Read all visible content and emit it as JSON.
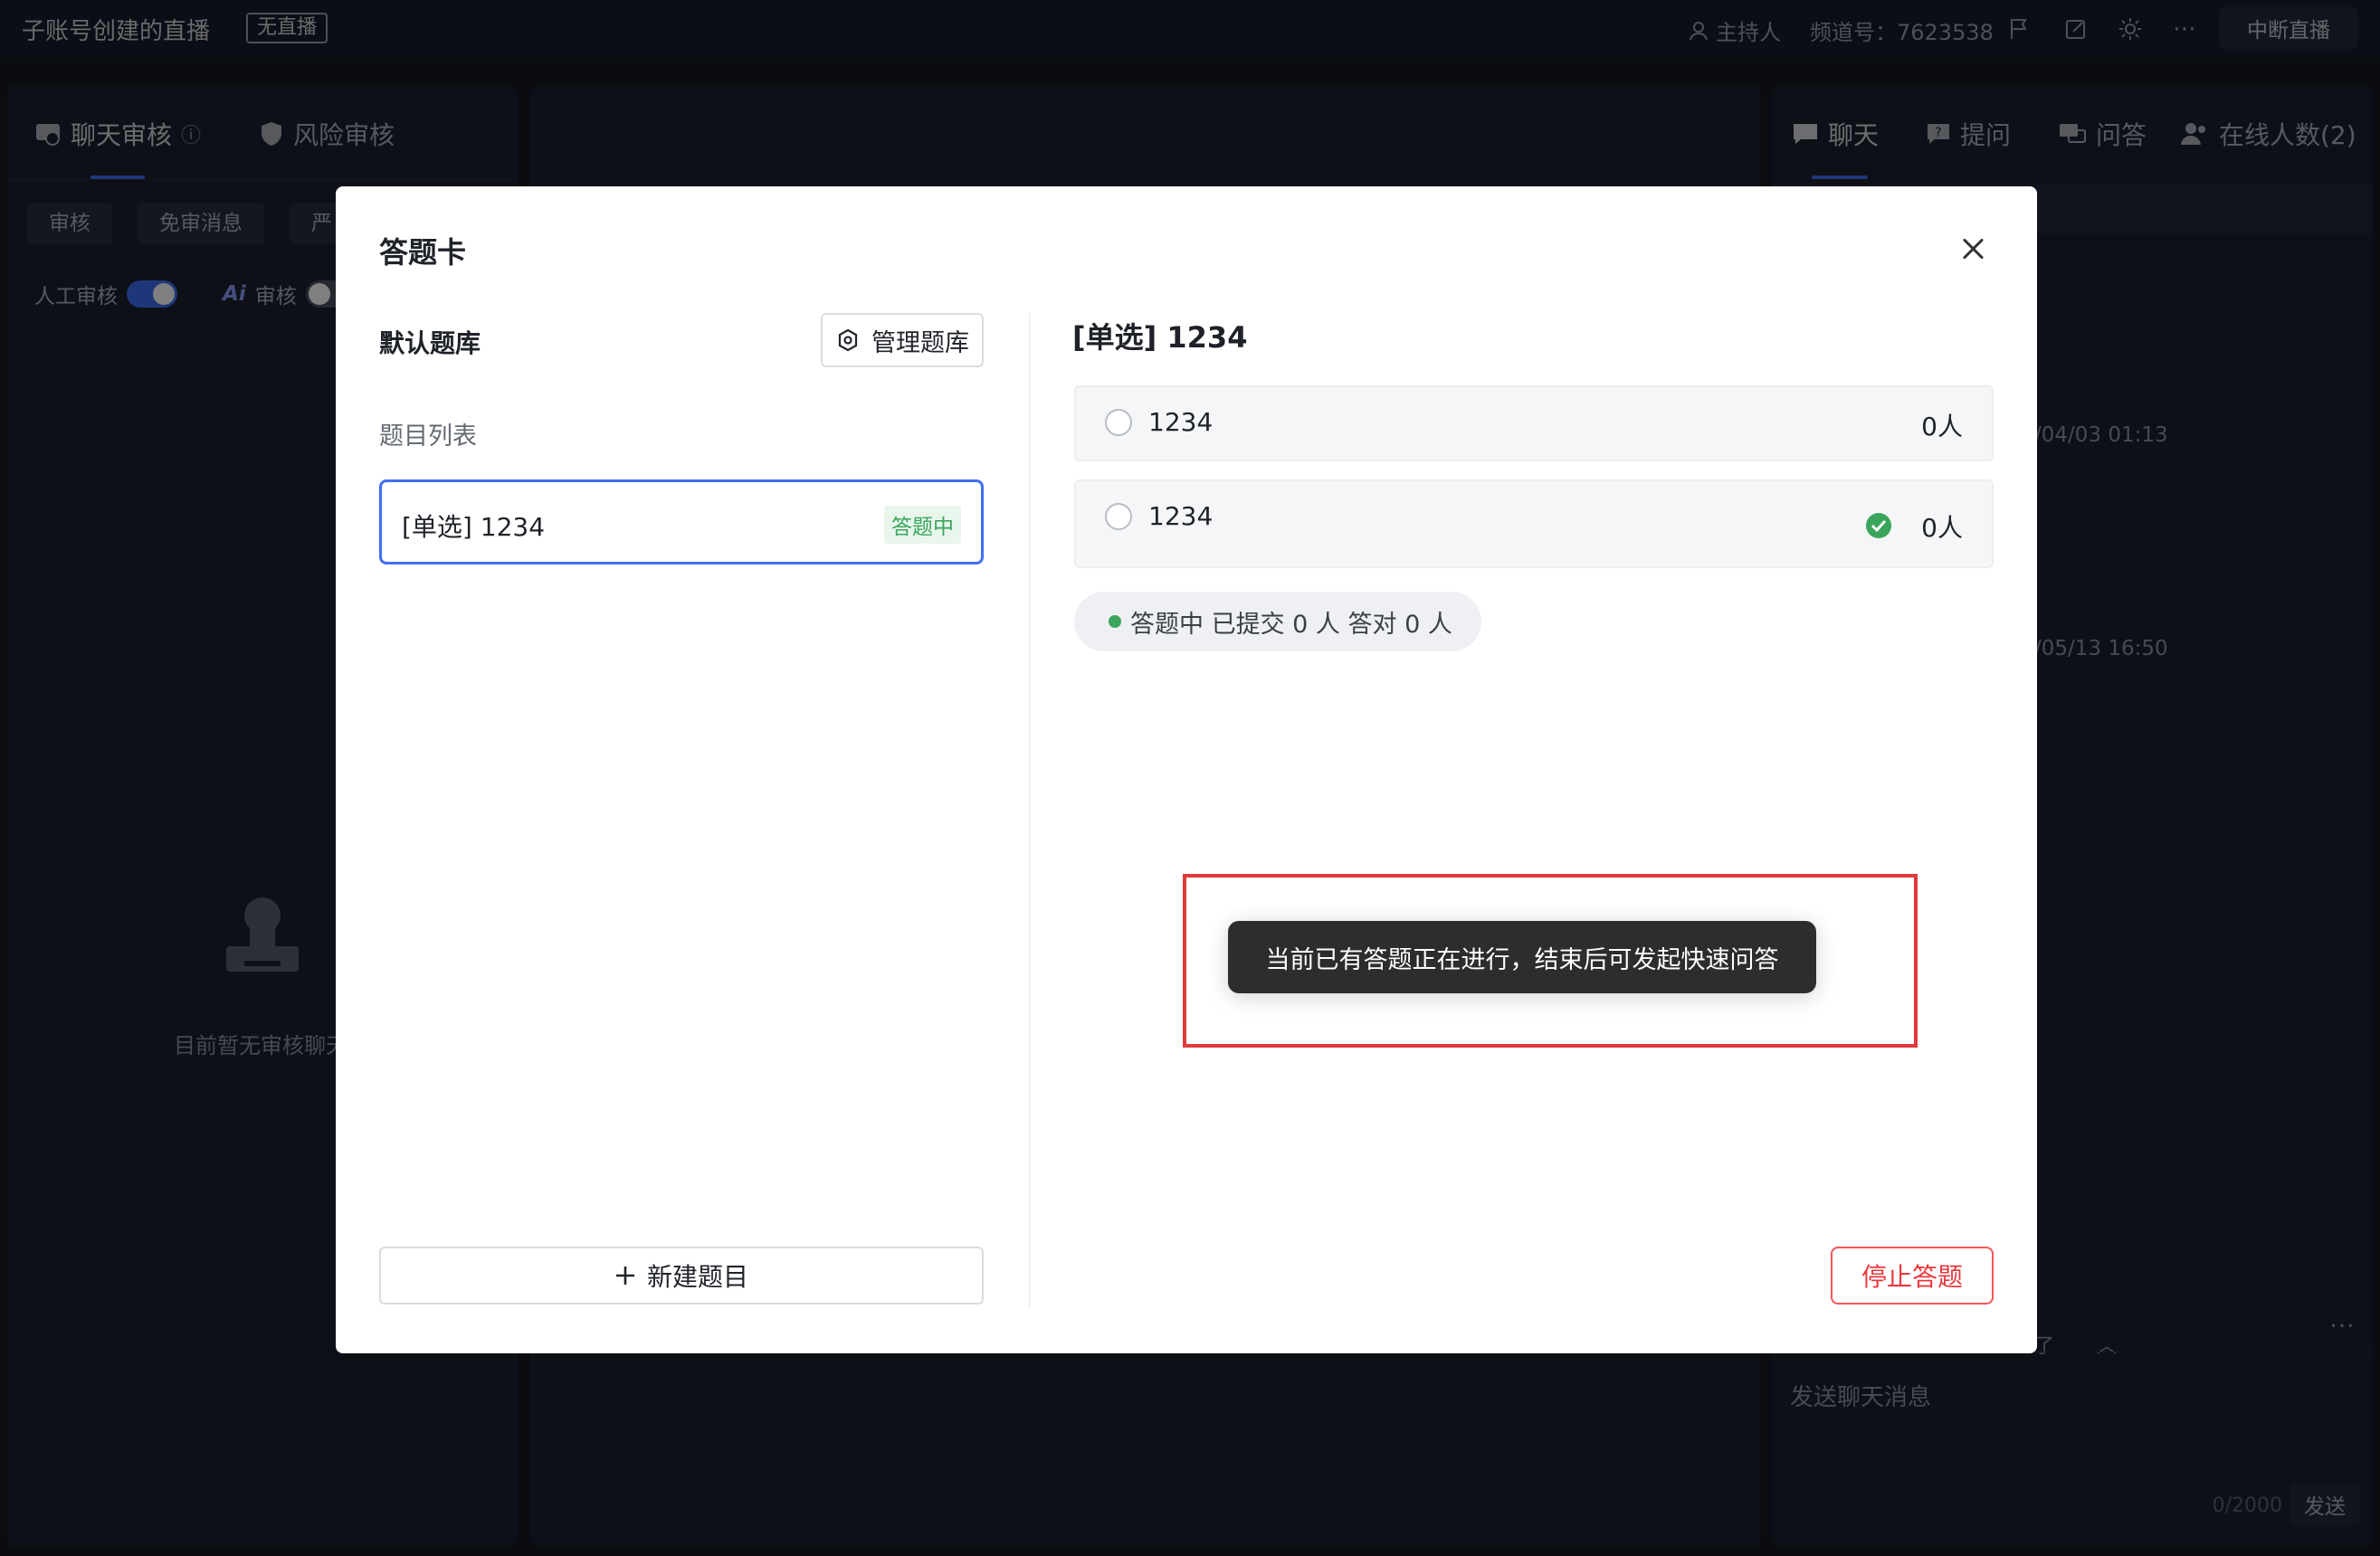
{
  "topbar": {
    "title": "子账号创建的直播",
    "live_badge": "无直播",
    "host_label": "主持人",
    "channel_label": "频道号：7623538",
    "end_live_label": "中断直播"
  },
  "left_panel": {
    "tabs": [
      {
        "label": "聊天审核",
        "icon": "chat-review-icon"
      },
      {
        "label": "风险审核",
        "icon": "shield-icon"
      }
    ],
    "chips": [
      "审核",
      "免审消息",
      "严"
    ],
    "toggles": [
      {
        "label": "人工审核",
        "on": true
      },
      {
        "label": "审核",
        "prefix": "Ai",
        "on": false
      }
    ],
    "empty_text": "目前暂无审核聊天"
  },
  "right_panel": {
    "tabs": [
      {
        "label": "聊天",
        "icon": "chat-icon"
      },
      {
        "label": "提问",
        "icon": "question-icon"
      },
      {
        "label": "问答",
        "icon": "qa-icon"
      },
      {
        "label": "在线人数(2)",
        "icon": "users-icon"
      }
    ],
    "timestamps": [
      "/04/03 01:13",
      "/05/13 16:50"
    ],
    "hint_fragment": "了",
    "input_placeholder": "发送聊天消息",
    "counter": "0/2000",
    "send_label": "发送"
  },
  "modal": {
    "title": "答题卡",
    "bank_name": "默认题库",
    "manage_label": "管理题库",
    "list_label": "题目列表",
    "questions": [
      {
        "text": "[单选] 1234",
        "status": "答题中"
      }
    ],
    "new_question_label": "新建题目",
    "detail": {
      "title": "[单选] 1234",
      "options": [
        {
          "text": "1234",
          "count": "0人",
          "correct": false
        },
        {
          "text": "1234",
          "count": "0人",
          "correct": true
        }
      ],
      "progress_text": "答题中 已提交 0 人 答对 0 人"
    },
    "stop_label": "停止答题",
    "toast_text": "当前已有答题正在进行，结束后可发起快速问答"
  },
  "colors": {
    "accent": "#3f6ff4",
    "success": "#3aa55b",
    "danger": "#e8383d",
    "highlight": "#e03b3b"
  }
}
